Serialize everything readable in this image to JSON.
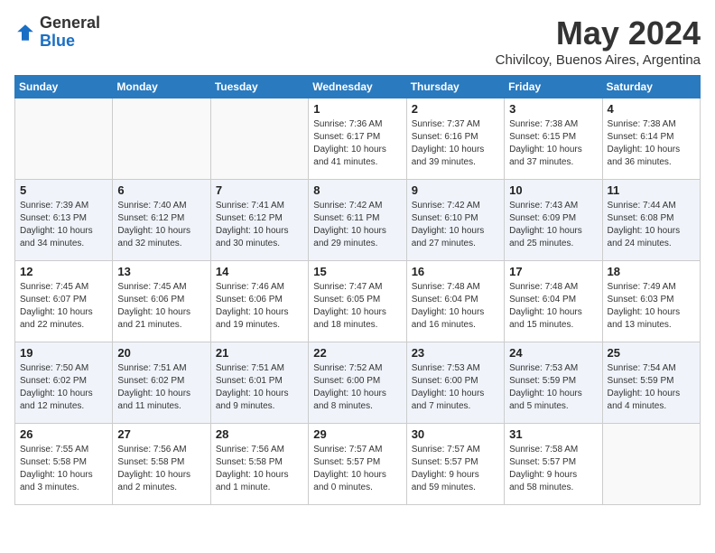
{
  "logo": {
    "general": "General",
    "blue": "Blue"
  },
  "title": "May 2024",
  "location": "Chivilcoy, Buenos Aires, Argentina",
  "headers": [
    "Sunday",
    "Monday",
    "Tuesday",
    "Wednesday",
    "Thursday",
    "Friday",
    "Saturday"
  ],
  "weeks": [
    [
      {
        "day": "",
        "info": ""
      },
      {
        "day": "",
        "info": ""
      },
      {
        "day": "",
        "info": ""
      },
      {
        "day": "1",
        "info": "Sunrise: 7:36 AM\nSunset: 6:17 PM\nDaylight: 10 hours\nand 41 minutes."
      },
      {
        "day": "2",
        "info": "Sunrise: 7:37 AM\nSunset: 6:16 PM\nDaylight: 10 hours\nand 39 minutes."
      },
      {
        "day": "3",
        "info": "Sunrise: 7:38 AM\nSunset: 6:15 PM\nDaylight: 10 hours\nand 37 minutes."
      },
      {
        "day": "4",
        "info": "Sunrise: 7:38 AM\nSunset: 6:14 PM\nDaylight: 10 hours\nand 36 minutes."
      }
    ],
    [
      {
        "day": "5",
        "info": "Sunrise: 7:39 AM\nSunset: 6:13 PM\nDaylight: 10 hours\nand 34 minutes."
      },
      {
        "day": "6",
        "info": "Sunrise: 7:40 AM\nSunset: 6:12 PM\nDaylight: 10 hours\nand 32 minutes."
      },
      {
        "day": "7",
        "info": "Sunrise: 7:41 AM\nSunset: 6:12 PM\nDaylight: 10 hours\nand 30 minutes."
      },
      {
        "day": "8",
        "info": "Sunrise: 7:42 AM\nSunset: 6:11 PM\nDaylight: 10 hours\nand 29 minutes."
      },
      {
        "day": "9",
        "info": "Sunrise: 7:42 AM\nSunset: 6:10 PM\nDaylight: 10 hours\nand 27 minutes."
      },
      {
        "day": "10",
        "info": "Sunrise: 7:43 AM\nSunset: 6:09 PM\nDaylight: 10 hours\nand 25 minutes."
      },
      {
        "day": "11",
        "info": "Sunrise: 7:44 AM\nSunset: 6:08 PM\nDaylight: 10 hours\nand 24 minutes."
      }
    ],
    [
      {
        "day": "12",
        "info": "Sunrise: 7:45 AM\nSunset: 6:07 PM\nDaylight: 10 hours\nand 22 minutes."
      },
      {
        "day": "13",
        "info": "Sunrise: 7:45 AM\nSunset: 6:06 PM\nDaylight: 10 hours\nand 21 minutes."
      },
      {
        "day": "14",
        "info": "Sunrise: 7:46 AM\nSunset: 6:06 PM\nDaylight: 10 hours\nand 19 minutes."
      },
      {
        "day": "15",
        "info": "Sunrise: 7:47 AM\nSunset: 6:05 PM\nDaylight: 10 hours\nand 18 minutes."
      },
      {
        "day": "16",
        "info": "Sunrise: 7:48 AM\nSunset: 6:04 PM\nDaylight: 10 hours\nand 16 minutes."
      },
      {
        "day": "17",
        "info": "Sunrise: 7:48 AM\nSunset: 6:04 PM\nDaylight: 10 hours\nand 15 minutes."
      },
      {
        "day": "18",
        "info": "Sunrise: 7:49 AM\nSunset: 6:03 PM\nDaylight: 10 hours\nand 13 minutes."
      }
    ],
    [
      {
        "day": "19",
        "info": "Sunrise: 7:50 AM\nSunset: 6:02 PM\nDaylight: 10 hours\nand 12 minutes."
      },
      {
        "day": "20",
        "info": "Sunrise: 7:51 AM\nSunset: 6:02 PM\nDaylight: 10 hours\nand 11 minutes."
      },
      {
        "day": "21",
        "info": "Sunrise: 7:51 AM\nSunset: 6:01 PM\nDaylight: 10 hours\nand 9 minutes."
      },
      {
        "day": "22",
        "info": "Sunrise: 7:52 AM\nSunset: 6:00 PM\nDaylight: 10 hours\nand 8 minutes."
      },
      {
        "day": "23",
        "info": "Sunrise: 7:53 AM\nSunset: 6:00 PM\nDaylight: 10 hours\nand 7 minutes."
      },
      {
        "day": "24",
        "info": "Sunrise: 7:53 AM\nSunset: 5:59 PM\nDaylight: 10 hours\nand 5 minutes."
      },
      {
        "day": "25",
        "info": "Sunrise: 7:54 AM\nSunset: 5:59 PM\nDaylight: 10 hours\nand 4 minutes."
      }
    ],
    [
      {
        "day": "26",
        "info": "Sunrise: 7:55 AM\nSunset: 5:58 PM\nDaylight: 10 hours\nand 3 minutes."
      },
      {
        "day": "27",
        "info": "Sunrise: 7:56 AM\nSunset: 5:58 PM\nDaylight: 10 hours\nand 2 minutes."
      },
      {
        "day": "28",
        "info": "Sunrise: 7:56 AM\nSunset: 5:58 PM\nDaylight: 10 hours\nand 1 minute."
      },
      {
        "day": "29",
        "info": "Sunrise: 7:57 AM\nSunset: 5:57 PM\nDaylight: 10 hours\nand 0 minutes."
      },
      {
        "day": "30",
        "info": "Sunrise: 7:57 AM\nSunset: 5:57 PM\nDaylight: 9 hours\nand 59 minutes."
      },
      {
        "day": "31",
        "info": "Sunrise: 7:58 AM\nSunset: 5:57 PM\nDaylight: 9 hours\nand 58 minutes."
      },
      {
        "day": "",
        "info": ""
      }
    ]
  ]
}
